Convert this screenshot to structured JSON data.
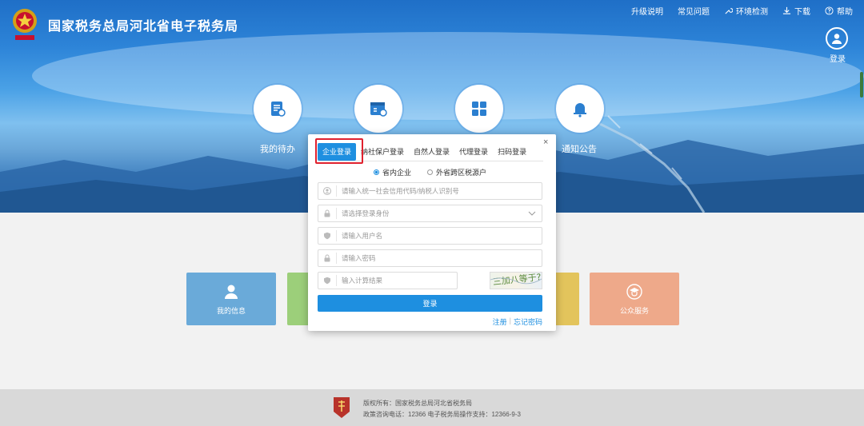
{
  "header": {
    "site_title": "国家税务总局河北省电子税务局",
    "emblem_icon": "tax-emblem-icon",
    "nav": [
      {
        "label": "升级说明",
        "icon": ""
      },
      {
        "label": "常见问题",
        "icon": ""
      },
      {
        "label": "环境检测",
        "icon": "wrench-icon"
      },
      {
        "label": "下载",
        "icon": "download-icon"
      },
      {
        "label": "帮助",
        "icon": "help-icon"
      }
    ],
    "login_label": "登录",
    "login_icon": "user-circle-icon"
  },
  "features": [
    {
      "label": "我的待办",
      "icon": "todo-doc-icon"
    },
    {
      "label": "",
      "icon": "calendar-icon"
    },
    {
      "label": "",
      "icon": "grid-apps-icon"
    },
    {
      "label": "通知公告",
      "icon": "bell-icon"
    }
  ],
  "tiles": [
    {
      "label": "我的信息",
      "icon": "person-icon",
      "color": "#6aaad9"
    },
    {
      "label": "",
      "icon": "",
      "color": "#9ccf7a"
    },
    {
      "label": "",
      "icon": "",
      "color": "#e3c45c"
    },
    {
      "label": "公众服务",
      "icon": "graduate-icon",
      "color": "#eea98a"
    }
  ],
  "login_dialog": {
    "close_symbol": "×",
    "tabs": [
      "企业登录",
      "纳社保户登录",
      "自然人登录",
      "代理登录",
      "扫码登录"
    ],
    "active_tab": 0,
    "region_options": [
      {
        "label": "省内企业",
        "selected": true
      },
      {
        "label": "外省跨区税源户",
        "selected": false
      }
    ],
    "fields": {
      "credit_code_placeholder": "请输入统一社会信用代码/纳税人识别号",
      "identity_placeholder": "请选择登录身份",
      "username_placeholder": "请输入用户名",
      "password_placeholder": "请输入密码",
      "captcha_placeholder": "输入计算结果"
    },
    "captcha_text": "三加八等于?",
    "submit_label": "登录",
    "register_link": "注册",
    "forgot_link": "忘记密码",
    "accent_color": "#1e8fe0"
  },
  "footer": {
    "copyright": "版权所有：国家税务总局河北省税务局",
    "contact": "政策咨询电话：12366  电子税务局操作支持：12366-9-3",
    "logo_icon": "hebei-tax-logo-icon"
  }
}
